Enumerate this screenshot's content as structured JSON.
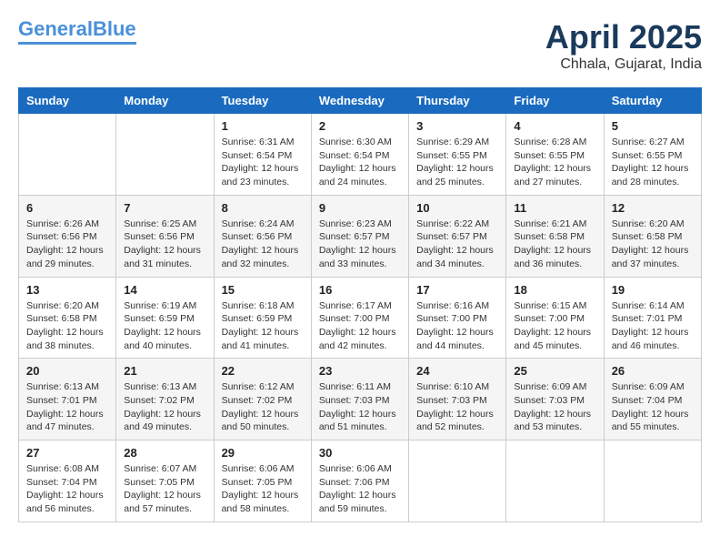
{
  "header": {
    "logo_line1": "General",
    "logo_line2": "Blue",
    "month_title": "April 2025",
    "location": "Chhala, Gujarat, India"
  },
  "days_of_week": [
    "Sunday",
    "Monday",
    "Tuesday",
    "Wednesday",
    "Thursday",
    "Friday",
    "Saturday"
  ],
  "weeks": [
    [
      {
        "day": "",
        "info": ""
      },
      {
        "day": "",
        "info": ""
      },
      {
        "day": "1",
        "info": "Sunrise: 6:31 AM\nSunset: 6:54 PM\nDaylight: 12 hours\nand 23 minutes."
      },
      {
        "day": "2",
        "info": "Sunrise: 6:30 AM\nSunset: 6:54 PM\nDaylight: 12 hours\nand 24 minutes."
      },
      {
        "day": "3",
        "info": "Sunrise: 6:29 AM\nSunset: 6:55 PM\nDaylight: 12 hours\nand 25 minutes."
      },
      {
        "day": "4",
        "info": "Sunrise: 6:28 AM\nSunset: 6:55 PM\nDaylight: 12 hours\nand 27 minutes."
      },
      {
        "day": "5",
        "info": "Sunrise: 6:27 AM\nSunset: 6:55 PM\nDaylight: 12 hours\nand 28 minutes."
      }
    ],
    [
      {
        "day": "6",
        "info": "Sunrise: 6:26 AM\nSunset: 6:56 PM\nDaylight: 12 hours\nand 29 minutes."
      },
      {
        "day": "7",
        "info": "Sunrise: 6:25 AM\nSunset: 6:56 PM\nDaylight: 12 hours\nand 31 minutes."
      },
      {
        "day": "8",
        "info": "Sunrise: 6:24 AM\nSunset: 6:56 PM\nDaylight: 12 hours\nand 32 minutes."
      },
      {
        "day": "9",
        "info": "Sunrise: 6:23 AM\nSunset: 6:57 PM\nDaylight: 12 hours\nand 33 minutes."
      },
      {
        "day": "10",
        "info": "Sunrise: 6:22 AM\nSunset: 6:57 PM\nDaylight: 12 hours\nand 34 minutes."
      },
      {
        "day": "11",
        "info": "Sunrise: 6:21 AM\nSunset: 6:58 PM\nDaylight: 12 hours\nand 36 minutes."
      },
      {
        "day": "12",
        "info": "Sunrise: 6:20 AM\nSunset: 6:58 PM\nDaylight: 12 hours\nand 37 minutes."
      }
    ],
    [
      {
        "day": "13",
        "info": "Sunrise: 6:20 AM\nSunset: 6:58 PM\nDaylight: 12 hours\nand 38 minutes."
      },
      {
        "day": "14",
        "info": "Sunrise: 6:19 AM\nSunset: 6:59 PM\nDaylight: 12 hours\nand 40 minutes."
      },
      {
        "day": "15",
        "info": "Sunrise: 6:18 AM\nSunset: 6:59 PM\nDaylight: 12 hours\nand 41 minutes."
      },
      {
        "day": "16",
        "info": "Sunrise: 6:17 AM\nSunset: 7:00 PM\nDaylight: 12 hours\nand 42 minutes."
      },
      {
        "day": "17",
        "info": "Sunrise: 6:16 AM\nSunset: 7:00 PM\nDaylight: 12 hours\nand 44 minutes."
      },
      {
        "day": "18",
        "info": "Sunrise: 6:15 AM\nSunset: 7:00 PM\nDaylight: 12 hours\nand 45 minutes."
      },
      {
        "day": "19",
        "info": "Sunrise: 6:14 AM\nSunset: 7:01 PM\nDaylight: 12 hours\nand 46 minutes."
      }
    ],
    [
      {
        "day": "20",
        "info": "Sunrise: 6:13 AM\nSunset: 7:01 PM\nDaylight: 12 hours\nand 47 minutes."
      },
      {
        "day": "21",
        "info": "Sunrise: 6:13 AM\nSunset: 7:02 PM\nDaylight: 12 hours\nand 49 minutes."
      },
      {
        "day": "22",
        "info": "Sunrise: 6:12 AM\nSunset: 7:02 PM\nDaylight: 12 hours\nand 50 minutes."
      },
      {
        "day": "23",
        "info": "Sunrise: 6:11 AM\nSunset: 7:03 PM\nDaylight: 12 hours\nand 51 minutes."
      },
      {
        "day": "24",
        "info": "Sunrise: 6:10 AM\nSunset: 7:03 PM\nDaylight: 12 hours\nand 52 minutes."
      },
      {
        "day": "25",
        "info": "Sunrise: 6:09 AM\nSunset: 7:03 PM\nDaylight: 12 hours\nand 53 minutes."
      },
      {
        "day": "26",
        "info": "Sunrise: 6:09 AM\nSunset: 7:04 PM\nDaylight: 12 hours\nand 55 minutes."
      }
    ],
    [
      {
        "day": "27",
        "info": "Sunrise: 6:08 AM\nSunset: 7:04 PM\nDaylight: 12 hours\nand 56 minutes."
      },
      {
        "day": "28",
        "info": "Sunrise: 6:07 AM\nSunset: 7:05 PM\nDaylight: 12 hours\nand 57 minutes."
      },
      {
        "day": "29",
        "info": "Sunrise: 6:06 AM\nSunset: 7:05 PM\nDaylight: 12 hours\nand 58 minutes."
      },
      {
        "day": "30",
        "info": "Sunrise: 6:06 AM\nSunset: 7:06 PM\nDaylight: 12 hours\nand 59 minutes."
      },
      {
        "day": "",
        "info": ""
      },
      {
        "day": "",
        "info": ""
      },
      {
        "day": "",
        "info": ""
      }
    ]
  ]
}
